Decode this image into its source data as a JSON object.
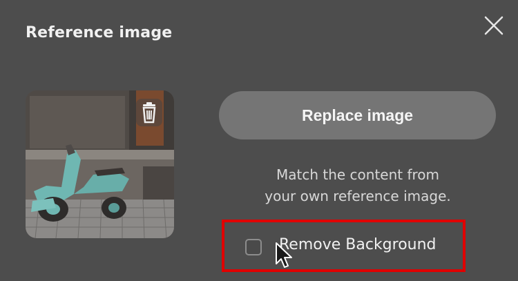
{
  "dialog": {
    "title": "Reference image",
    "close_icon": "close-icon",
    "trash_icon": "trash-icon",
    "replace_label": "Replace image",
    "description_line1": "Match the content from",
    "description_line2": "your own reference image.",
    "remove_background": {
      "label": "Remove Background",
      "checked": false
    }
  },
  "colors": {
    "background": "#4d4d4d",
    "button": "#757575",
    "highlight": "#e00000",
    "scooter": "#6fb7b2"
  }
}
